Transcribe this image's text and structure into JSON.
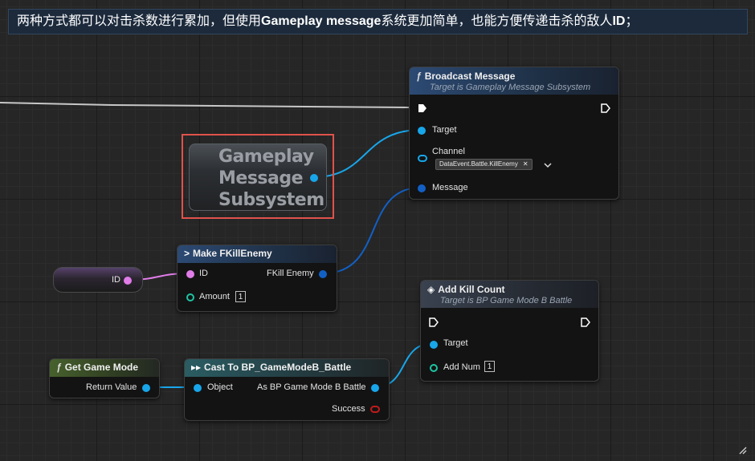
{
  "caption": {
    "part1": "两种方式都可以对击杀数进行累加，但使用",
    "bold1": "Gameplay message",
    "part2": "系统更加简单，也能方便传递击杀的敌人",
    "bold2": "ID",
    "part3": "；"
  },
  "colors": {
    "object_pin": "#18a6ea",
    "struct_pin": "#1260c4",
    "int_pin": "#1ec4a4",
    "name_pin": "#e07ce8",
    "highlight": "#e0524b",
    "exec_wire": "#c8c8c8"
  },
  "broadcast": {
    "title": "Broadcast Message",
    "subtitle": "Target is Gameplay Message Subsystem",
    "target_label": "Target",
    "channel_label": "Channel",
    "channel_value": "DataEvent.Battle.KillEnemy",
    "message_label": "Message",
    "icon": "function-icon"
  },
  "subsystem": {
    "line1": "Gameplay",
    "line2": "Message",
    "line3": "Subsystem"
  },
  "make_struct": {
    "title": "Make FKillEnemy",
    "id_label": "ID",
    "amount_label": "Amount",
    "amount_value": "1",
    "output_label": "FKill Enemy"
  },
  "id_getter": {
    "label": "ID"
  },
  "add_kill": {
    "title": "Add Kill Count",
    "subtitle": "Target is BP Game Mode B Battle",
    "target_label": "Target",
    "addnum_label": "Add Num",
    "addnum_value": "1"
  },
  "get_game_mode": {
    "title": "Get Game Mode",
    "return_label": "Return Value"
  },
  "cast": {
    "title": "Cast To BP_GameModeB_Battle",
    "object_label": "Object",
    "output_label": "As BP Game Mode B Battle",
    "success_label": "Success"
  }
}
